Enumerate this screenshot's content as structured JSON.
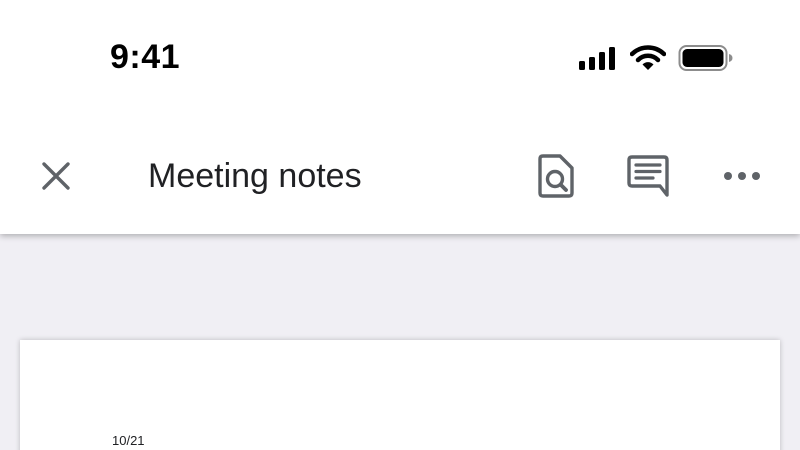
{
  "status_bar": {
    "time": "9:41",
    "icons": [
      "cellular-signal-icon",
      "wifi-icon",
      "battery-icon"
    ]
  },
  "toolbar": {
    "close_icon": "close-icon",
    "title": "Meeting notes",
    "actions": [
      "preview-icon",
      "comments-icon",
      "more-icon"
    ]
  },
  "document": {
    "first_line": "10/21"
  },
  "colors": {
    "toolbar_background": "#ffffff",
    "canvas_background": "#f0eff4",
    "icon_gray": "#5f6368",
    "title_text": "#202124"
  }
}
